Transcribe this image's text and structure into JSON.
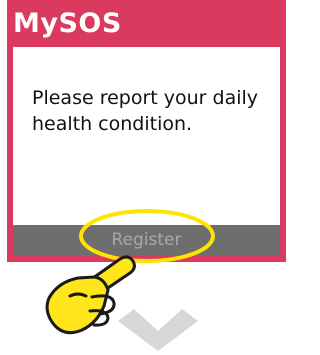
{
  "app": {
    "title": "MySOS"
  },
  "dialog": {
    "message": "Please report your daily health condition."
  },
  "actions": {
    "register_label": "Register"
  },
  "colors": {
    "brand": "#d93a5e",
    "panel": "#ffffff",
    "button_bg": "#6e6e6e",
    "button_text": "#a8a8a8",
    "highlight": "#ffe400",
    "arrow": "#d7d7d7"
  },
  "icons": {
    "pointer": "pointing-hand-icon",
    "next": "chevron-down-icon"
  }
}
